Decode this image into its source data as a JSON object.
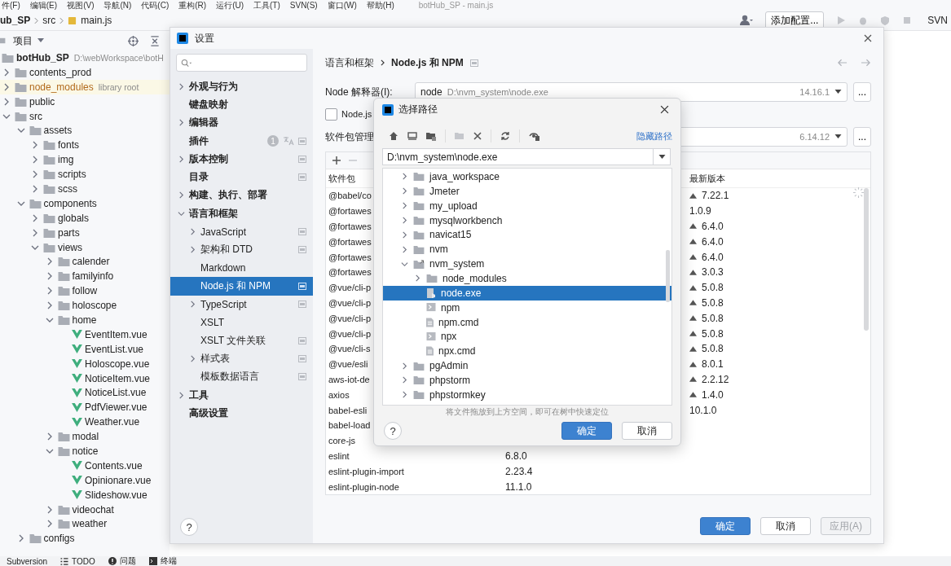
{
  "menu_bar": {
    "items": [
      "件(F)",
      "编辑(E)",
      "视图(V)",
      "导航(N)",
      "代码(C)",
      "重构(R)",
      "运行(U)",
      "工具(T)",
      "SVN(S)",
      "窗口(W)",
      "帮助(H)"
    ],
    "title": "botHub_SP - main.js"
  },
  "nav_bar": {
    "breadcrumbs": [
      "ub_SP",
      "src",
      "main.js"
    ],
    "run_config": "添加配置...",
    "vcs": "SVN"
  },
  "project_panel": {
    "title": "项目",
    "tree": [
      {
        "name": "botHub_SP",
        "kind": "root",
        "hint": "D:\\webWorkspace\\botH",
        "children": [
          {
            "name": "contents_prod",
            "kind": "folder",
            "expanded": false
          },
          {
            "name": "node_modules",
            "kind": "library",
            "hint": "library root",
            "expanded": false
          },
          {
            "name": "public",
            "kind": "folder",
            "expanded": false
          },
          {
            "name": "src",
            "kind": "folder",
            "expanded": true,
            "children": [
              {
                "name": "assets",
                "kind": "folder",
                "expanded": true,
                "children": [
                  {
                    "name": "fonts",
                    "kind": "folder",
                    "expanded": false
                  },
                  {
                    "name": "img",
                    "kind": "folder",
                    "expanded": false
                  },
                  {
                    "name": "scripts",
                    "kind": "folder",
                    "expanded": false
                  },
                  {
                    "name": "scss",
                    "kind": "folder",
                    "expanded": false
                  }
                ]
              },
              {
                "name": "components",
                "kind": "folder",
                "expanded": true,
                "children": [
                  {
                    "name": "globals",
                    "kind": "folder",
                    "expanded": false
                  },
                  {
                    "name": "parts",
                    "kind": "folder",
                    "expanded": false
                  },
                  {
                    "name": "views",
                    "kind": "folder",
                    "expanded": true,
                    "children": [
                      {
                        "name": "calender",
                        "kind": "folder",
                        "expanded": false
                      },
                      {
                        "name": "familyinfo",
                        "kind": "folder",
                        "expanded": false
                      },
                      {
                        "name": "follow",
                        "kind": "folder",
                        "expanded": false
                      },
                      {
                        "name": "holoscope",
                        "kind": "folder",
                        "expanded": false
                      },
                      {
                        "name": "home",
                        "kind": "folder",
                        "expanded": true,
                        "children": [
                          {
                            "name": "EventItem.vue",
                            "kind": "vue"
                          },
                          {
                            "name": "EventList.vue",
                            "kind": "vue"
                          },
                          {
                            "name": "Holoscope.vue",
                            "kind": "vue"
                          },
                          {
                            "name": "NoticeItem.vue",
                            "kind": "vue"
                          },
                          {
                            "name": "NoticeList.vue",
                            "kind": "vue"
                          },
                          {
                            "name": "PdfViewer.vue",
                            "kind": "vue"
                          },
                          {
                            "name": "Weather.vue",
                            "kind": "vue"
                          }
                        ]
                      },
                      {
                        "name": "modal",
                        "kind": "folder",
                        "expanded": false
                      },
                      {
                        "name": "notice",
                        "kind": "folder",
                        "expanded": true,
                        "children": [
                          {
                            "name": "Contents.vue",
                            "kind": "vue"
                          },
                          {
                            "name": "Opinionare.vue",
                            "kind": "vue"
                          },
                          {
                            "name": "Slideshow.vue",
                            "kind": "vue"
                          }
                        ]
                      },
                      {
                        "name": "videochat",
                        "kind": "folder",
                        "expanded": false
                      },
                      {
                        "name": "weather",
                        "kind": "folder",
                        "expanded": false
                      }
                    ]
                  }
                ]
              },
              {
                "name": "configs",
                "kind": "folder",
                "expanded": false
              }
            ]
          }
        ]
      }
    ]
  },
  "status_bar": [
    {
      "label": "Subversion",
      "kind": "text"
    },
    {
      "label": "TODO",
      "kind": "list"
    },
    {
      "label": "问题",
      "kind": "alert"
    },
    {
      "label": "终端",
      "kind": "console"
    }
  ],
  "settings": {
    "title": "设置",
    "sidebar": [
      {
        "label": "外观与行为",
        "expanded": false,
        "selected": false,
        "project": false
      },
      {
        "label": "键盘映射",
        "selected": false,
        "project": false
      },
      {
        "label": "编辑器",
        "expanded": false,
        "selected": false,
        "project": false
      },
      {
        "label": "插件",
        "selected": false,
        "project": true,
        "badge": "1"
      },
      {
        "label": "版本控制",
        "expanded": false,
        "selected": false,
        "project": true
      },
      {
        "label": "目录",
        "selected": false,
        "project": true
      },
      {
        "label": "构建、执行、部署",
        "expanded": false,
        "selected": false,
        "project": false
      },
      {
        "label": "语言和框架",
        "expanded": true,
        "selected": false,
        "project": false,
        "children": [
          {
            "label": "JavaScript",
            "expanded": false,
            "selected": false,
            "project": true
          },
          {
            "label": "架构和 DTD",
            "expanded": false,
            "selected": false,
            "project": true
          },
          {
            "label": "Markdown",
            "selected": false,
            "project": false
          },
          {
            "label": "Node.js 和 NPM",
            "selected": true,
            "project": true
          },
          {
            "label": "TypeScript",
            "expanded": false,
            "selected": false,
            "project": true
          },
          {
            "label": "XSLT",
            "selected": false,
            "project": false
          },
          {
            "label": "XSLT 文件关联",
            "selected": false,
            "project": true
          },
          {
            "label": "样式表",
            "expanded": false,
            "selected": false,
            "project": true
          },
          {
            "label": "模板数据语言",
            "selected": false,
            "project": true
          }
        ]
      },
      {
        "label": "工具",
        "expanded": false,
        "selected": false,
        "project": false
      },
      {
        "label": "高级设置",
        "selected": false,
        "project": false
      }
    ],
    "breadcrumb": [
      "语言和框架",
      "Node.js 和 NPM"
    ],
    "help": "?",
    "interpreter": {
      "label": "Node 解释器(I):",
      "name": "node",
      "path": "D:\\nvm_system\\node.exe",
      "version": "14.16.1",
      "browse": "..."
    },
    "checkbox": {
      "label": "Node.js",
      "checked": false
    },
    "package_manager": {
      "label": "软件包管理",
      "version": "6.14.12",
      "browse": "..."
    },
    "packages": {
      "columns": [
        "软件包",
        "最新版本"
      ],
      "rows": [
        {
          "name": "@babel/co",
          "latest": "7.22.1",
          "upgrade": true
        },
        {
          "name": "@fortawes",
          "latest": "1.0.9",
          "upgrade": false
        },
        {
          "name": "@fortawes",
          "latest": "6.4.0",
          "upgrade": true
        },
        {
          "name": "@fortawes",
          "latest": "6.4.0",
          "upgrade": true
        },
        {
          "name": "@fortawes",
          "latest": "6.4.0",
          "upgrade": true
        },
        {
          "name": "@fortawes",
          "latest": "3.0.3",
          "upgrade": true
        },
        {
          "name": "@vue/cli-p",
          "latest": "5.0.8",
          "upgrade": true
        },
        {
          "name": "@vue/cli-p",
          "latest": "5.0.8",
          "upgrade": true
        },
        {
          "name": "@vue/cli-p",
          "latest": "5.0.8",
          "upgrade": true
        },
        {
          "name": "@vue/cli-p",
          "latest": "5.0.8",
          "upgrade": true
        },
        {
          "name": "@vue/cli-s",
          "latest": "5.0.8",
          "upgrade": true
        },
        {
          "name": "@vue/esli",
          "latest": "8.0.1",
          "upgrade": true
        },
        {
          "name": "aws-iot-de",
          "latest": "2.2.12",
          "upgrade": true
        },
        {
          "name": "axios",
          "latest": "1.4.0",
          "upgrade": true
        },
        {
          "name": "babel-esli",
          "latest": "10.1.0",
          "upgrade": false
        },
        {
          "name": "babel-load",
          "upgrade": false
        },
        {
          "name": "core-js",
          "upgrade": false
        },
        {
          "name": "eslint",
          "version": "6.8.0",
          "upgrade": false
        },
        {
          "name": "eslint-plugin-import",
          "version": "2.23.4",
          "upgrade": false
        },
        {
          "name": "eslint-plugin-node",
          "version": "11.1.0",
          "upgrade": false
        }
      ]
    },
    "buttons": [
      {
        "label": "确定",
        "kind": "primary",
        "disabled": false
      },
      {
        "label": "取消",
        "kind": "normal",
        "disabled": false
      },
      {
        "label": "应用(A)",
        "kind": "normal",
        "disabled": true
      }
    ]
  },
  "chooser": {
    "title": "选择路径",
    "hide_path": "隐藏路径",
    "path": "D:\\nvm_system\\node.exe",
    "tree": [
      {
        "name": "java_workspace",
        "kind": "folder",
        "expanded": false,
        "selected": false
      },
      {
        "name": "Jmeter",
        "kind": "folder",
        "expanded": false,
        "selected": false
      },
      {
        "name": "my_upload",
        "kind": "folder",
        "expanded": false,
        "selected": false
      },
      {
        "name": "mysqlworkbench",
        "kind": "folder",
        "expanded": false,
        "selected": false
      },
      {
        "name": "navicat15",
        "kind": "folder",
        "expanded": false,
        "selected": false
      },
      {
        "name": "nvm",
        "kind": "folder",
        "expanded": false,
        "selected": false
      },
      {
        "name": "nvm_system",
        "kind": "link",
        "expanded": true,
        "selected": false,
        "children": [
          {
            "name": "node_modules",
            "kind": "folder",
            "expanded": false,
            "selected": false
          },
          {
            "name": "node.exe",
            "kind": "node",
            "selected": true
          },
          {
            "name": "npm",
            "kind": "shell",
            "selected": false
          },
          {
            "name": "npm.cmd",
            "kind": "script",
            "selected": false
          },
          {
            "name": "npx",
            "kind": "shell",
            "selected": false
          },
          {
            "name": "npx.cmd",
            "kind": "script",
            "selected": false
          }
        ]
      },
      {
        "name": "pgAdmin",
        "kind": "folder",
        "expanded": false,
        "selected": false
      },
      {
        "name": "phpstorm",
        "kind": "folder",
        "expanded": false,
        "selected": false
      },
      {
        "name": "phpstormkey",
        "kind": "folder",
        "expanded": false,
        "selected": false
      }
    ],
    "hint": "将文件拖放到上方空间，即可在树中快速定位",
    "help": "?",
    "buttons": [
      {
        "label": "确定",
        "kind": "primary"
      },
      {
        "label": "取消",
        "kind": "normal"
      }
    ]
  }
}
